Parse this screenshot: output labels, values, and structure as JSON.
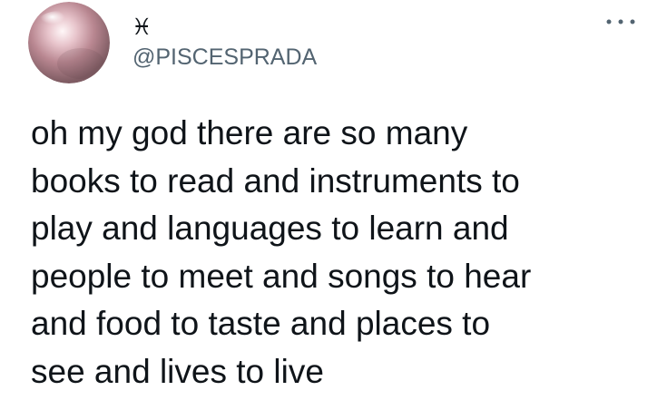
{
  "tweet": {
    "author": {
      "display_name": "♓︎",
      "handle": "@PISCESPRADA",
      "avatar": "pearl-avatar"
    },
    "more_icon": "more-horizontal-icon",
    "text_lines": [
      "oh my god there are so many",
      "books to read and instruments to",
      "play and languages to learn and",
      "people to meet and songs to hear",
      "and food to taste and places to",
      "see and lives to live"
    ]
  },
  "colors": {
    "text_primary": "#0f1419",
    "text_secondary": "#536471",
    "background": "#ffffff"
  }
}
